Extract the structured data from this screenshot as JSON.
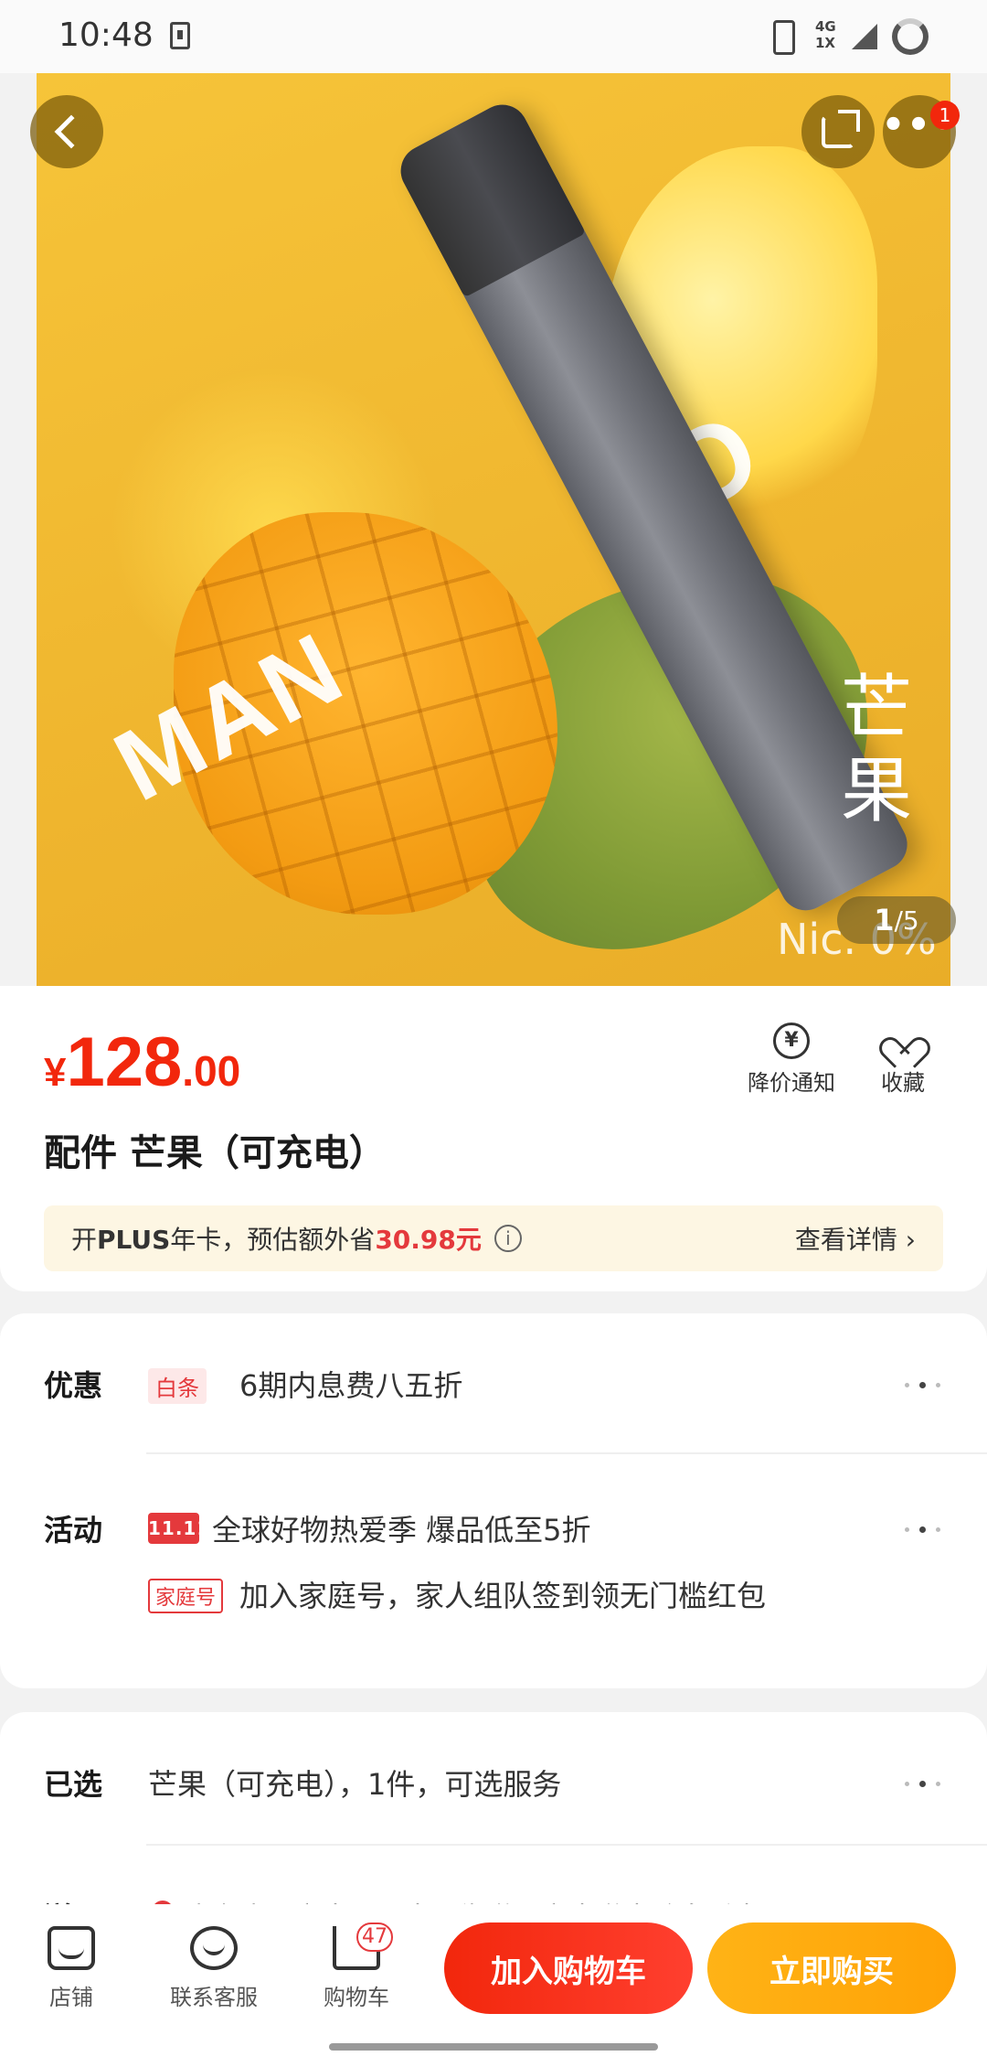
{
  "status_bar": {
    "time": "10:48",
    "network": "4G\n1X"
  },
  "gallery": {
    "current": "1",
    "total": "/5",
    "image_text": {
      "word1": "MAN",
      "word2": "GO",
      "cn": "芒果",
      "nic": "Nic. 0%"
    },
    "more_badge": "1"
  },
  "price": {
    "currency": "¥",
    "integer": "128",
    "decimal": ".00"
  },
  "actions": {
    "price_alert": "降价通知",
    "favorite": "收藏"
  },
  "product": {
    "title": "配件 芒果（可充电）"
  },
  "plus_bar": {
    "prefix": "开",
    "plus": "PLUS",
    "middle": "年卡，预估额外省",
    "saving": "30.98元",
    "detail": "查看详情 ›"
  },
  "promo": {
    "discount_label": "优惠",
    "baitiao_tag": "白条",
    "baitiao_text": "6期内息费八五折",
    "activity_label": "活动",
    "activity_logo": "11.11",
    "activity_text": "全球好物热爱季 爆品低至5折",
    "family_tag": "家庭号",
    "family_text": "加入家庭号，家人组队签到领无门槛红包"
  },
  "selection": {
    "selected_label": "已选",
    "selected_text": "芒果（可充电），1件，可选服务",
    "ship_label": "送至",
    "ship_text": "广东广州市南沙区南沙街道环市大道中矿泉溪水"
  },
  "bottom_bar": {
    "store": "店铺",
    "service": "联系客服",
    "cart": "购物车",
    "cart_count": "47",
    "add_to_cart": "加入购物车",
    "buy_now": "立即购买"
  }
}
